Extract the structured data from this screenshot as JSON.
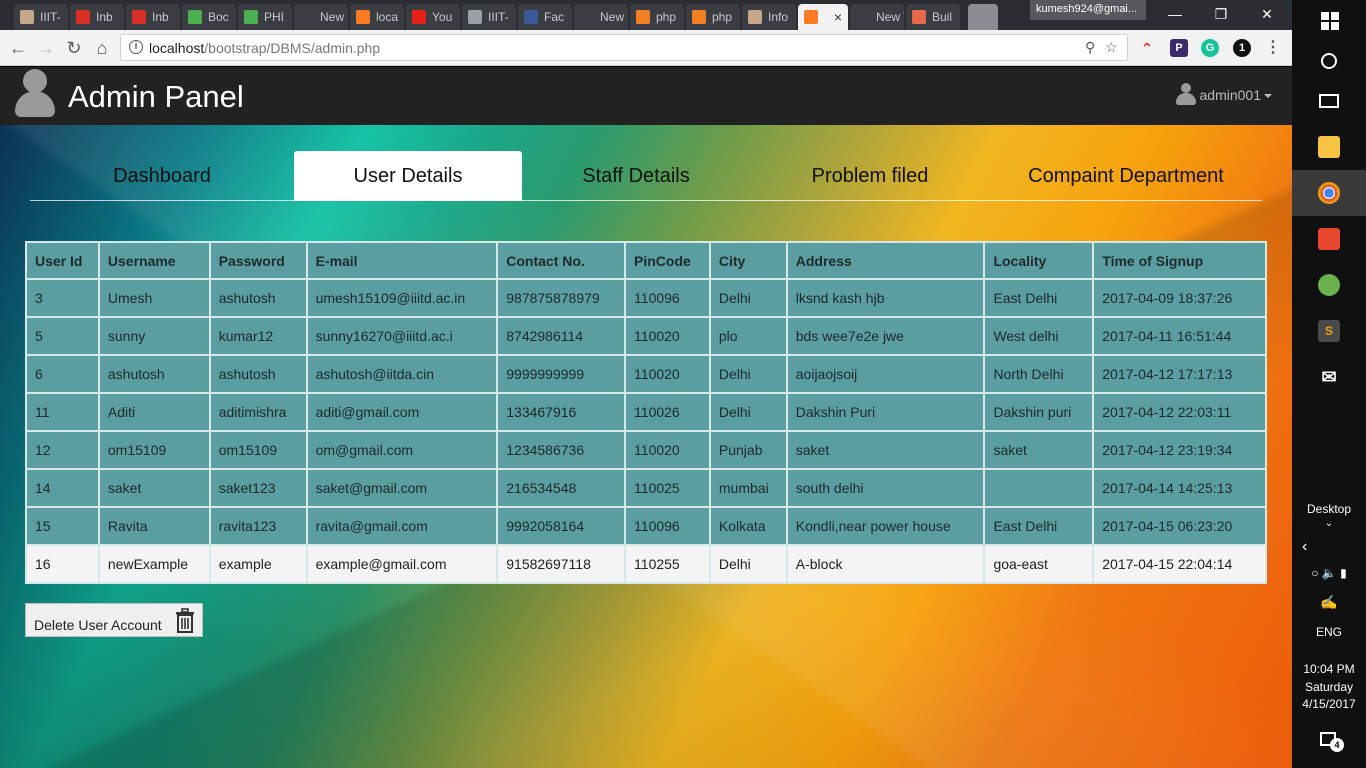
{
  "browser": {
    "tabs": [
      {
        "label": "IIIT-",
        "icon": "bookmark-icon",
        "color": "#c8a68a"
      },
      {
        "label": "Inb",
        "icon": "gmail-icon",
        "color": "#d93025"
      },
      {
        "label": "Inb",
        "icon": "gmail-icon",
        "color": "#d93025"
      },
      {
        "label": "Boc",
        "icon": "w3-icon",
        "color": "#4caf50"
      },
      {
        "label": "PHI",
        "icon": "w3-icon",
        "color": "#4caf50"
      },
      {
        "label": "New Ta",
        "icon": "",
        "color": ""
      },
      {
        "label": "loca",
        "icon": "xampp-icon",
        "color": "#fb7a24"
      },
      {
        "label": "You",
        "icon": "youtube-icon",
        "color": "#e62117"
      },
      {
        "label": "IIIT-",
        "icon": "page-icon",
        "color": "#9aa0a6"
      },
      {
        "label": "Fac",
        "icon": "facebook-icon",
        "color": "#3b5998"
      },
      {
        "label": "New Ta",
        "icon": "",
        "color": ""
      },
      {
        "label": "php",
        "icon": "stackoverflow-icon",
        "color": "#f48024"
      },
      {
        "label": "php",
        "icon": "stackoverflow-icon",
        "color": "#f48024"
      },
      {
        "label": "Info",
        "icon": "bookmark-icon",
        "color": "#c8a68a"
      },
      {
        "label": "",
        "icon": "xampp-icon",
        "color": "#fb7a24",
        "active": true
      },
      {
        "label": "New Ta",
        "icon": "",
        "color": ""
      },
      {
        "label": "Buil",
        "icon": "plus-icon",
        "color": "#e8684a"
      }
    ],
    "profile": "kumesh924@gmai...",
    "url_host": "localhost",
    "url_path": "/bootstrap/DBMS/admin.php"
  },
  "navbar": {
    "title": "Admin Panel",
    "username": "admin001"
  },
  "nav_tabs": [
    {
      "label": "Dashboard",
      "active": false
    },
    {
      "label": "User Details",
      "active": true
    },
    {
      "label": "Staff Details",
      "active": false
    },
    {
      "label": "Problem filed",
      "active": false
    },
    {
      "label": "Compaint Department",
      "active": false
    }
  ],
  "table": {
    "headers": [
      "User Id",
      "Username",
      "Password",
      "E-mail",
      "Contact No.",
      "PinCode",
      "City",
      "Address",
      "Locality",
      "Time of Signup"
    ],
    "rows": [
      [
        "3",
        "Umesh",
        "ashutosh",
        "umesh15109@iiitd.ac.in",
        "987875878979",
        "110096",
        "Delhi",
        "lksnd kash hjb",
        "East Delhi",
        "2017-04-09 18:37:26"
      ],
      [
        "5",
        "sunny",
        "kumar12",
        "sunny16270@iiitd.ac.i",
        "8742986114",
        "110020",
        "plo",
        "bds wee7e2e jwe",
        "West delhi",
        "2017-04-11 16:51:44"
      ],
      [
        "6",
        "ashutosh",
        "ashutosh",
        "ashutosh@iitda.cin",
        "9999999999",
        "110020",
        "Delhi",
        "aoijaojsoij",
        "North Delhi",
        "2017-04-12 17:17:13"
      ],
      [
        "11",
        "Aditi",
        "aditimishra",
        "aditi@gmail.com",
        "133467916",
        "110026",
        "Delhi",
        "Dakshin Puri",
        "Dakshin puri",
        "2017-04-12 22:03:11"
      ],
      [
        "12",
        "om15109",
        "om15109",
        "om@gmail.com",
        "1234586736",
        "110020",
        "Punjab",
        "saket",
        "saket",
        "2017-04-12 23:19:34"
      ],
      [
        "14",
        "saket",
        "saket123",
        "saket@gmail.com",
        "216534548",
        "110025",
        "mumbai",
        "south delhi",
        "",
        "2017-04-14 14:25:13"
      ],
      [
        "15",
        "Ravita",
        "ravita123",
        "ravita@gmail.com",
        "9992058164",
        "110096",
        "Kolkata",
        "Kondli,near power house",
        "East Delhi",
        "2017-04-15 06:23:20"
      ],
      [
        "16",
        "newExample",
        "example",
        "example@gmail.com",
        "91582697118",
        "110255",
        "Delhi",
        "A-block",
        "goa-east",
        "2017-04-15 22:04:14"
      ]
    ]
  },
  "delete_button": {
    "label": "Delete User Account",
    "icon": "trash-icon"
  },
  "taskbar": {
    "desktop_label": "Desktop",
    "language": "ENG",
    "time": "10:04 PM",
    "day": "Saturday",
    "date": "4/15/2017",
    "notifications": "4"
  },
  "colors": {
    "navbar_bg": "#222222",
    "table_row": "#5b9ea1",
    "table_row_light": "#f4f4f4"
  }
}
